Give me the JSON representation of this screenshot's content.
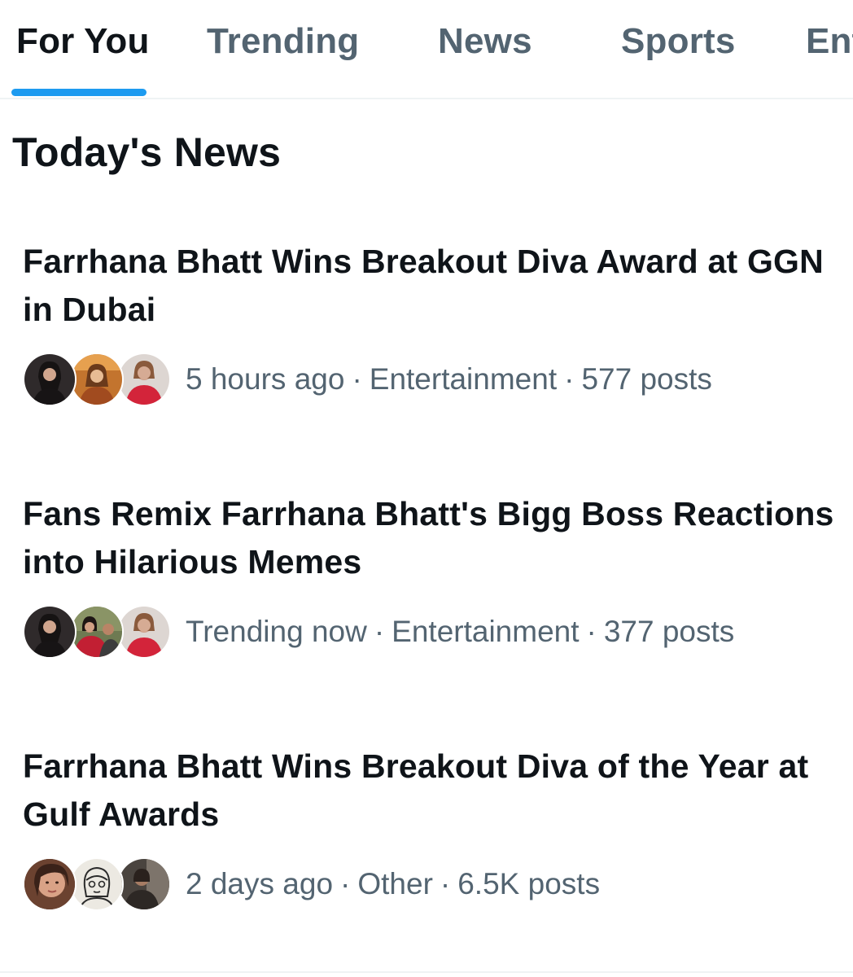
{
  "tabs": [
    {
      "label": "For You",
      "active": true
    },
    {
      "label": "Trending",
      "active": false
    },
    {
      "label": "News",
      "active": false
    },
    {
      "label": "Sports",
      "active": false
    },
    {
      "label": "Ent",
      "active": false
    }
  ],
  "section_title": "Today's News",
  "accent_color": "#1d9bf0",
  "news": [
    {
      "headline": "Farrhana Bhatt Wins Breakout Diva Award at GGN in Dubai",
      "time": "5 hours ago",
      "category": "Entertainment",
      "posts": "577 posts",
      "avatars": [
        "woman-dark-hair-avatar",
        "woman-golden-dress-avatar",
        "woman-red-outfit-avatar"
      ]
    },
    {
      "headline": "Fans Remix Farrhana Bhatt's Bigg Boss Reactions into Hilarious Memes",
      "time": "Trending now",
      "category": "Entertainment",
      "posts": "377 posts",
      "avatars": [
        "woman-dark-hair-avatar",
        "group-red-saree-avatar",
        "woman-red-outfit-avatar"
      ]
    },
    {
      "headline": "Farrhana Bhatt Wins Breakout Diva of the Year at Gulf Awards",
      "time": "2 days ago",
      "category": "Other",
      "posts": "6.5K posts",
      "avatars": [
        "woman-closeup-avatar",
        "sketch-drawing-avatar",
        "person-dark-scene-avatar"
      ]
    }
  ]
}
